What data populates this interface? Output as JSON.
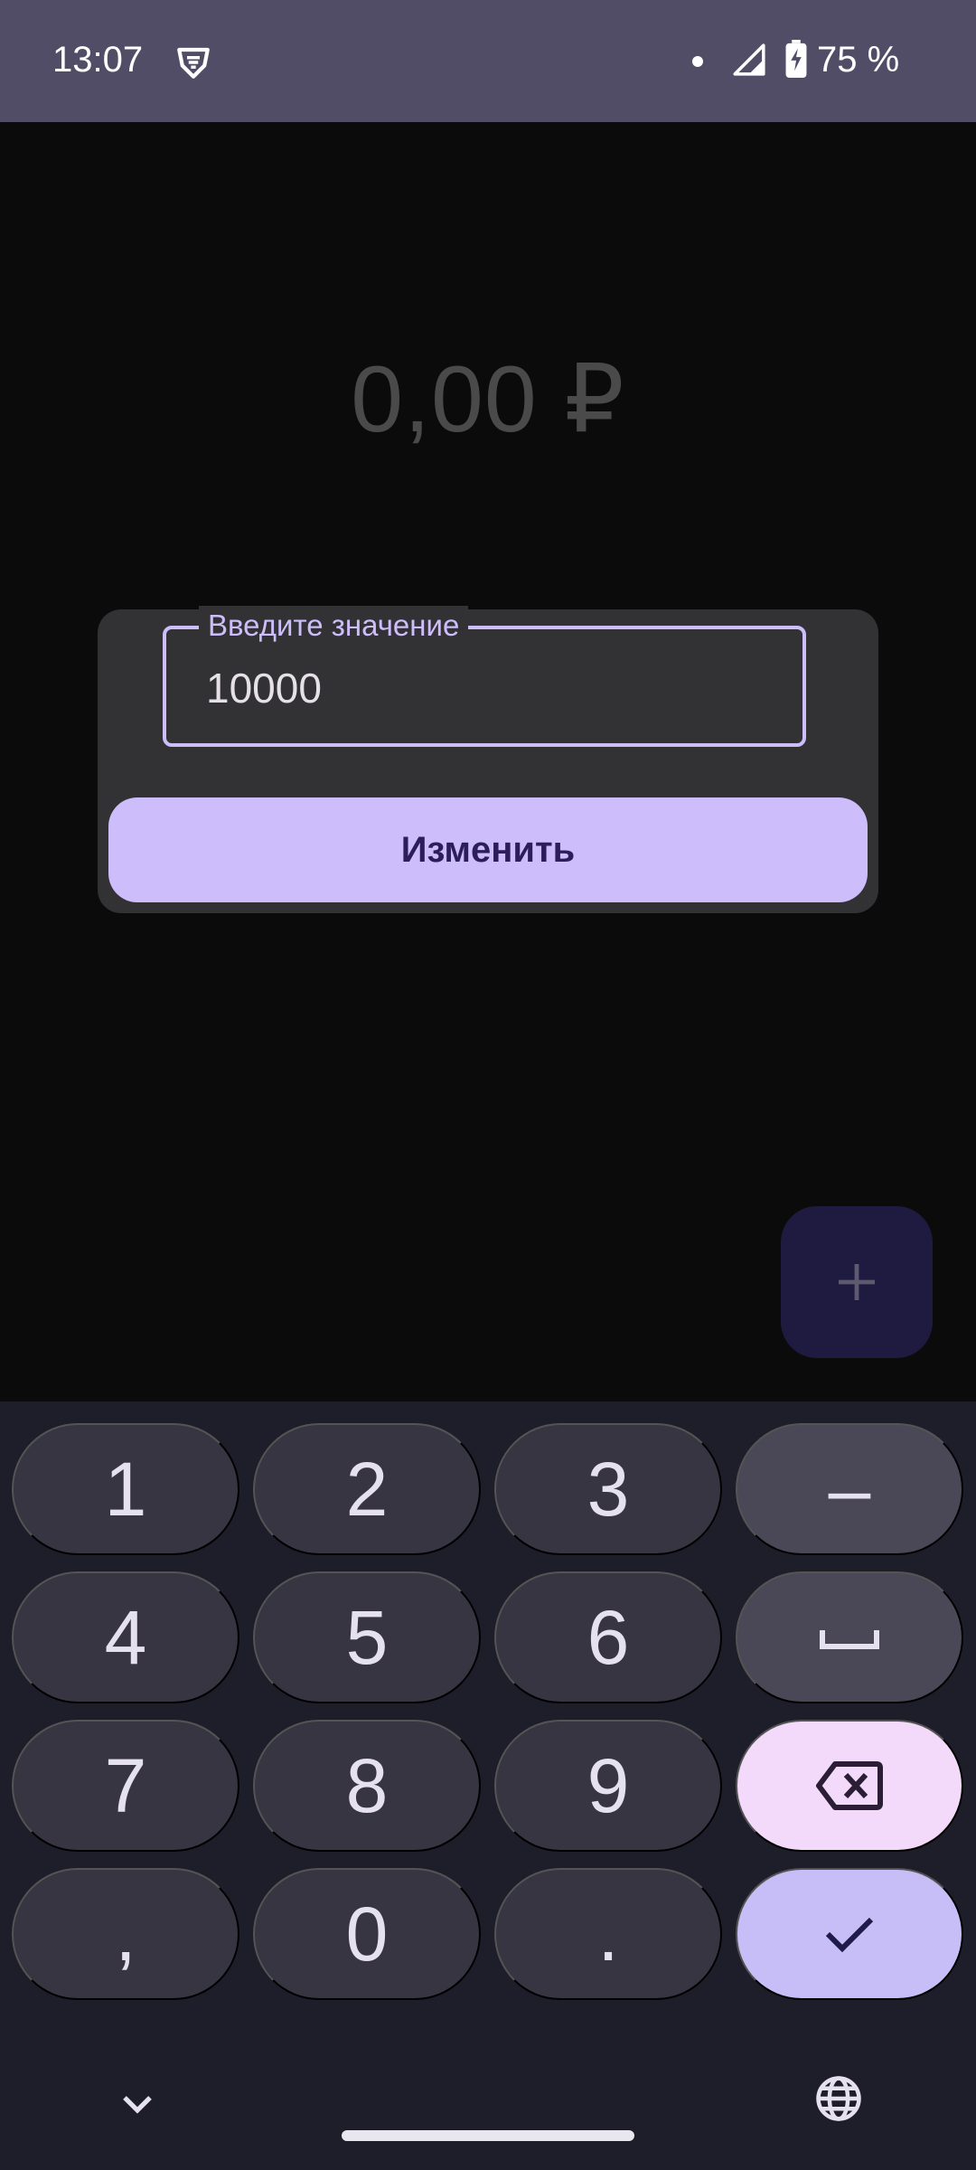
{
  "status_bar": {
    "time": "13:07",
    "battery_percent": "75 %",
    "icons": [
      "vpn-icon",
      "notification-dot",
      "signal-icon",
      "battery-charging-icon"
    ]
  },
  "balance": "0,00 ₽",
  "dialog": {
    "field_label": "Введите значение",
    "field_value": "10000",
    "submit_label": "Изменить"
  },
  "fab": {
    "icon": "plus-icon"
  },
  "keyboard": {
    "keys": [
      "1",
      "2",
      "3",
      "–",
      "4",
      "5",
      "6",
      "␣",
      "7",
      "8",
      "9",
      "⌫",
      ",",
      "0",
      ".",
      " ✓"
    ],
    "digits": {
      "k1": "1",
      "k2": "2",
      "k3": "3",
      "k4": "4",
      "k5": "5",
      "k6": "6",
      "k7": "7",
      "k8": "8",
      "k9": "9",
      "k0": "0"
    },
    "minus": "–",
    "comma": ",",
    "dot": ".",
    "icons": [
      "space-icon",
      "backspace-icon",
      "check-icon",
      "chevron-down-icon",
      "globe-icon"
    ]
  },
  "colors": {
    "status_bar": "#524d67",
    "background": "#0b0b0b",
    "accent": "#cdbdfa",
    "keyboard_bg": "#1e1d2a",
    "delete_key": "#f3d9fa",
    "enter_key": "#c8bef7"
  }
}
